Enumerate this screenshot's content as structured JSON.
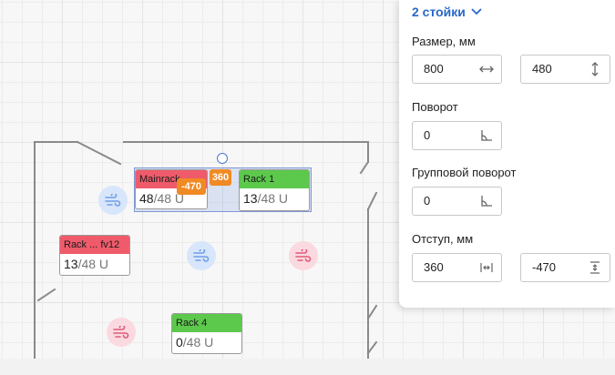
{
  "panel": {
    "title": "2 стойки",
    "size_label": "Размер, мм",
    "width_value": "800",
    "depth_value": "480",
    "rotation_label": "Поворот",
    "rotation_value": "0",
    "group_rotation_label": "Групповой поворот",
    "group_rotation_value": "0",
    "offset_label": "Отступ, мм",
    "offset_x_value": "360",
    "offset_y_value": "-470"
  },
  "canvas": {
    "badges": {
      "horizontal": "360",
      "vertical": "-470"
    },
    "racks": [
      {
        "name": "Mainrack",
        "used": "48",
        "total": "/48 U",
        "status": "red"
      },
      {
        "name": "Rack 1",
        "used": "13",
        "total": "/48 U",
        "status": "green"
      },
      {
        "name": "Rack ... fv12",
        "used": "13",
        "total": "/48 U",
        "status": "red"
      },
      {
        "name": "Rack 4",
        "used": "0",
        "total": "/48 U",
        "status": "green"
      }
    ],
    "fans": [
      {
        "kind": "cooling",
        "color": "#6f9ee8"
      },
      {
        "kind": "cooling",
        "color": "#6f9ee8"
      },
      {
        "kind": "heating",
        "color": "#e05a78"
      },
      {
        "kind": "heating",
        "color": "#e05a78"
      }
    ]
  },
  "colors": {
    "accent": "#2a67c9",
    "rack_red": "#ef5b6b",
    "rack_green": "#5cc94c",
    "badge_orange": "#f08a24"
  }
}
